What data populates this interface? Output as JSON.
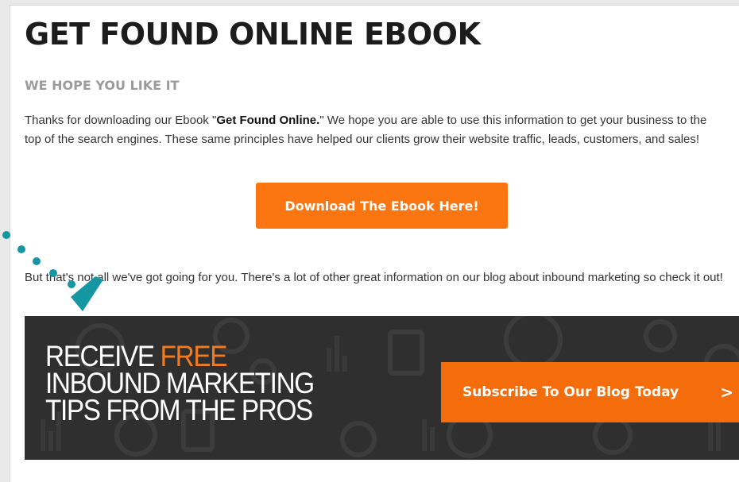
{
  "page": {
    "title": "GET FOUND ONLINE EBOOK",
    "subtitle": "WE HOPE YOU LIKE IT",
    "intro_before": "Thanks for downloading our Ebook \"",
    "intro_bold": "Get Found Online.",
    "intro_after": "\"  We hope you are able to use this information to get your business to the top of the search engines.  These same principles have helped our clients grow their website traffic, leads, customers, and sales!",
    "download_button": "Download The Ebook Here!",
    "blog_text": "But that's not all we've got going for you. There's a lot of other great information on our blog about inbound marketing so check it out!"
  },
  "banner": {
    "line1_prefix": "RECEIVE ",
    "line1_highlight": "FREE",
    "line2": "INBOUND MARKETING",
    "line3": "TIPS FROM THE PROS",
    "subscribe_button": "Subscribe To Our Blog Today",
    "subscribe_chevron": ">"
  },
  "colors": {
    "accent": "#fb7510",
    "banner_bg": "#2f2f2f",
    "pointer": "#1596a3"
  },
  "icons": [
    "arrow-pointer-icon",
    "chevron-right-icon",
    "banner-background-icons"
  ]
}
